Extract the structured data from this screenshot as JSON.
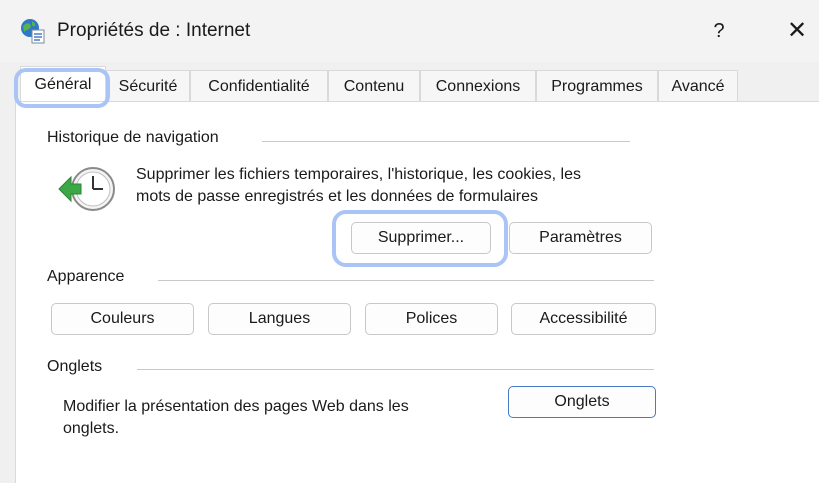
{
  "window": {
    "title": "Propriétés de : Internet",
    "help_label": "?",
    "close_label": "✕"
  },
  "tabs": [
    {
      "label": "Général",
      "active": true
    },
    {
      "label": "Sécurité"
    },
    {
      "label": "Confidentialité"
    },
    {
      "label": "Contenu"
    },
    {
      "label": "Connexions"
    },
    {
      "label": "Programmes"
    },
    {
      "label": "Avancé"
    }
  ],
  "history": {
    "label": "Historique de navigation",
    "description_line1": "Supprimer les fichiers temporaires, l'historique, les cookies, les",
    "description_line2": "mots de passe enregistrés et les données de formulaires",
    "delete_label": "Supprimer...",
    "settings_label": "Paramètres"
  },
  "appearance": {
    "label": "Apparence",
    "colors_label": "Couleurs",
    "languages_label": "Langues",
    "fonts_label": "Polices",
    "accessibility_label": "Accessibilité"
  },
  "tabs_group": {
    "label": "Onglets",
    "description_line1": "Modifier la présentation des pages Web dans les",
    "description_line2": "onglets.",
    "button_label": "Onglets"
  },
  "colors": {
    "highlight": "#a9c4f5",
    "primary_border": "#4a7ac6",
    "clock_arrow": "#3aa845"
  }
}
